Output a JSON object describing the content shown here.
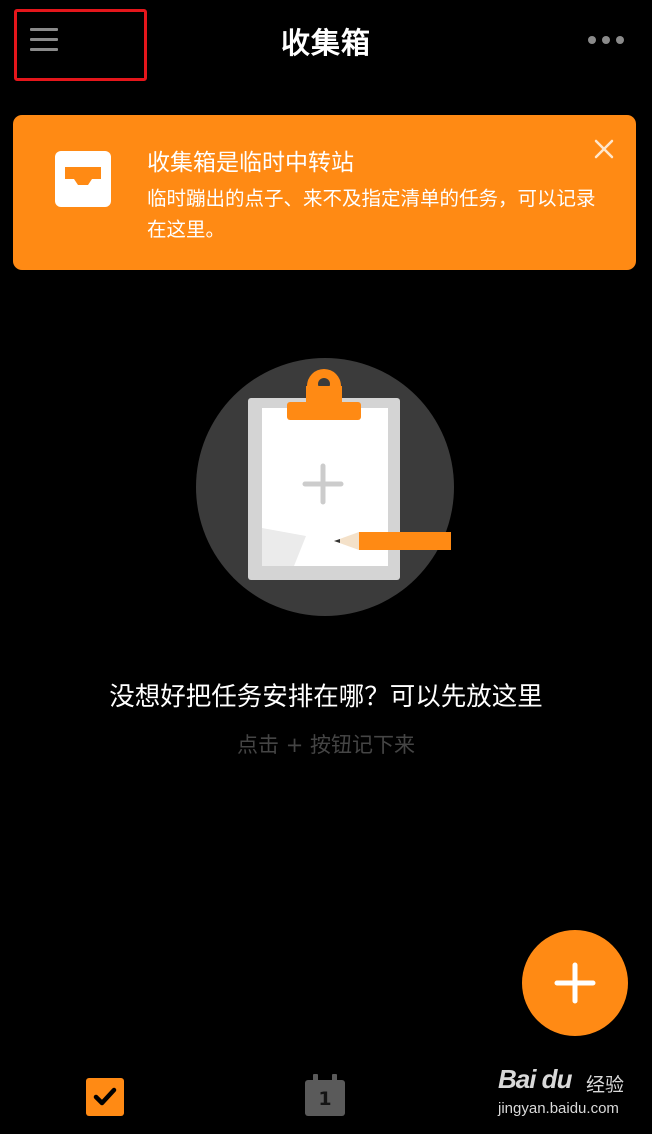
{
  "header": {
    "title": "收集箱",
    "menu_icon": "hamburger-menu-icon",
    "more_icon": "more-horizontal-icon"
  },
  "banner": {
    "title": "收集箱是临时中转站",
    "text": "临时蹦出的点子、来不及指定清单的任务，可以记录在这里。",
    "icon": "inbox-tray-icon",
    "close_icon": "close-icon"
  },
  "empty_state": {
    "illustration": "clipboard-pencil-illustration",
    "title": "没想好把任务安排在哪？可以先放这里",
    "hint": "点击 + 按钮记下来"
  },
  "fab": {
    "icon": "plus-icon"
  },
  "bottom_nav": {
    "tasks_icon": "checkbox-checked-icon",
    "calendar_icon": "calendar-icon",
    "calendar_day": "1"
  },
  "watermark": {
    "brand": "Bai du",
    "brand_cn": "经验",
    "url": "jingyan.baidu.com"
  },
  "colors": {
    "accent": "#ff8a14",
    "background": "#000000",
    "highlight": "#e5161b",
    "muted_text": "#454545"
  }
}
